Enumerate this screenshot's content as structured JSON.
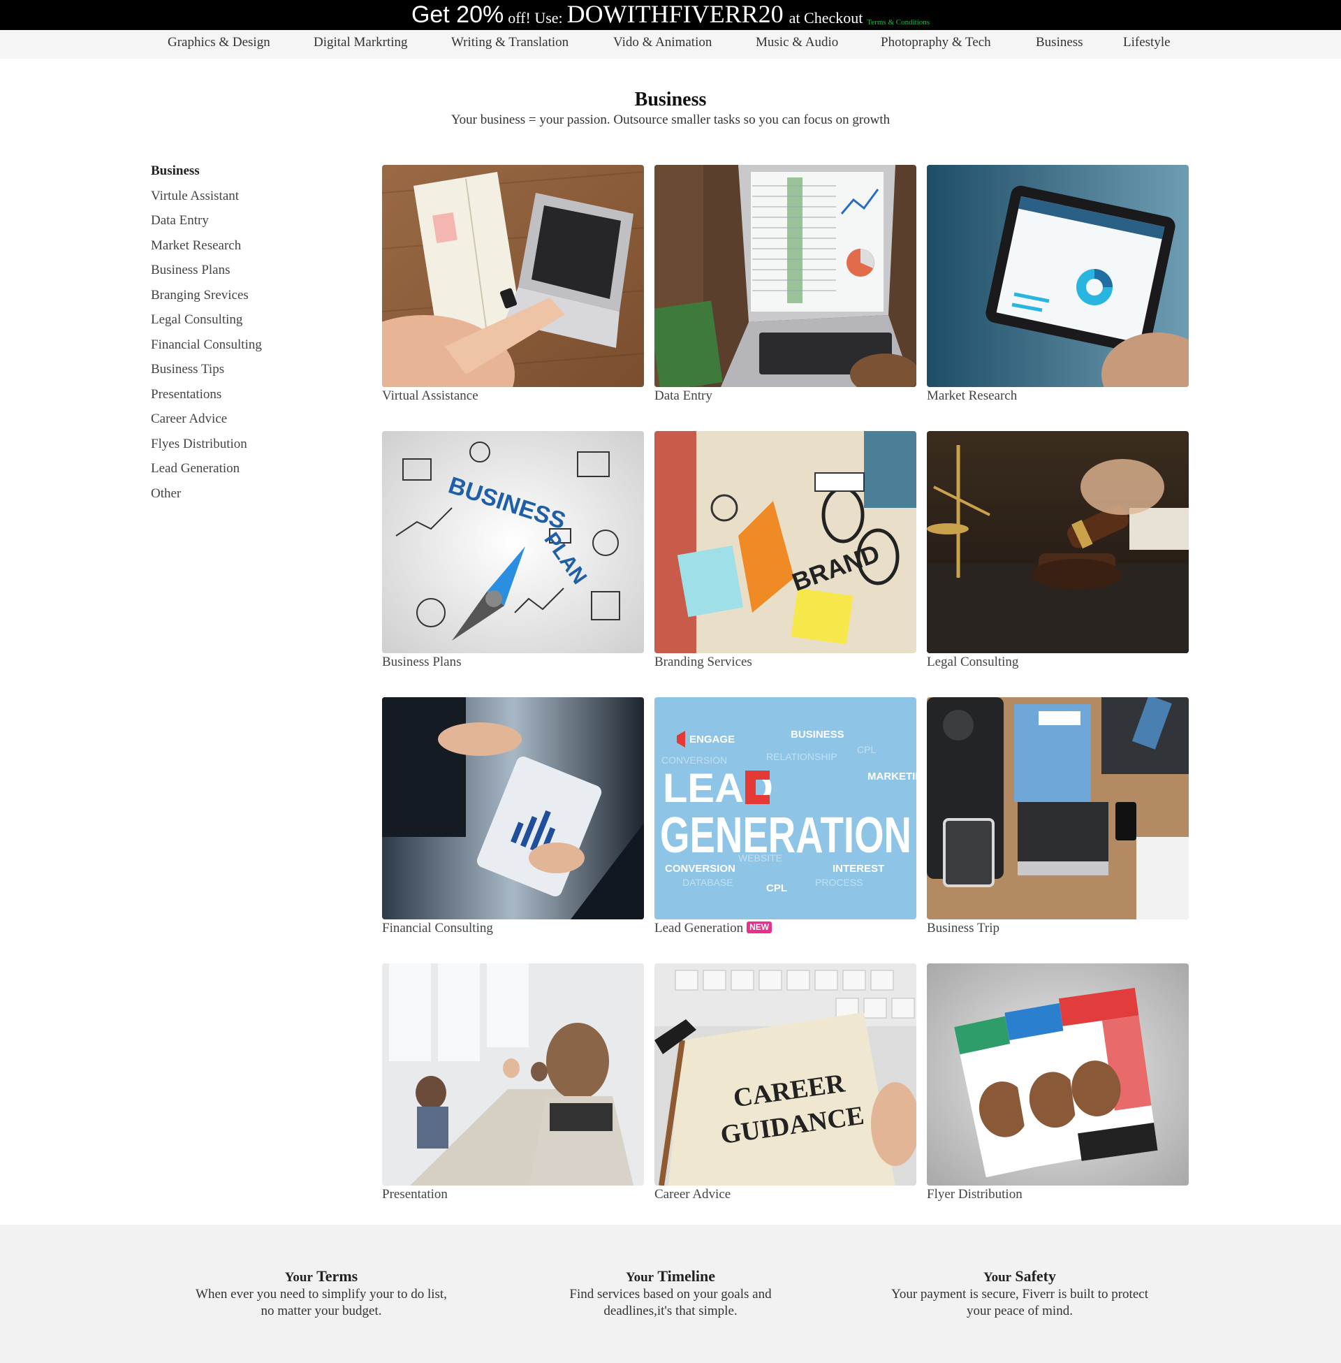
{
  "promo": {
    "get": "Get 20%",
    "off_use": "off! Use:",
    "code": "DOWITHFIVERR20",
    "at_checkout": "at Checkout",
    "terms": "Terms & Conditions"
  },
  "nav": {
    "items": [
      "Graphics & Design",
      "Digital Markrting",
      "Writing & Translation",
      "Vido & Animation",
      "Music & Audio",
      "Photopraphy & Tech",
      "Business",
      "Lifestyle"
    ]
  },
  "header": {
    "title": "Business",
    "subtitle": "Your business = your passion. Outsource smaller tasks so you can focus on growth"
  },
  "sidebar": {
    "heading": "Business",
    "items": [
      "Virtule Assistant",
      "Data Entry",
      "Market Research",
      "Business Plans",
      "Branging Srevices",
      "Legal Consulting",
      "Financial Consulting",
      "Business Tips",
      "Presentations",
      "Career Advice",
      "Flyes Distribution",
      "Lead Generation",
      "Other"
    ]
  },
  "cards": [
    {
      "label": "Virtual Assistance",
      "image": "laptop-desk-photo"
    },
    {
      "label": "Data Entry",
      "image": "spreadsheet-laptop-photo"
    },
    {
      "label": "Market Research",
      "image": "tablet-dashboard-photo"
    },
    {
      "label": "Business Plans",
      "image": "business-plan-sketch"
    },
    {
      "label": "Branding Services",
      "image": "brand-doodle-photo"
    },
    {
      "label": "Legal Consulting",
      "image": "gavel-scales-photo"
    },
    {
      "label": "Financial Consulting",
      "image": "handshake-tablet-photo"
    },
    {
      "label": "Lead Generation",
      "badge": "NEW",
      "image": "lead-generation-illustration"
    },
    {
      "label": "Business Trip",
      "image": "travel-flatlay-photo"
    },
    {
      "label": "Presentation",
      "image": "meeting-room-photo"
    },
    {
      "label": "Career Advice",
      "image": "career-guidance-notebook-photo"
    },
    {
      "label": "Flyer Distribution",
      "image": "flyer-mockup-photo"
    }
  ],
  "footer": {
    "columns": [
      {
        "title_a": "Your",
        "title_b": "Terms",
        "text_1": "When ever you need to simplify your to do list,",
        "text_2": "no matter your budget."
      },
      {
        "title_a": "Your",
        "title_b": "Timeline",
        "text_1": "Find services based on your goals and",
        "text_2": "deadlines,it's that simple."
      },
      {
        "title_a": "Your",
        "title_b": "Safety",
        "text_1": "Your payment is secure, Fiverr is built to protect",
        "text_2": "your peace of mind."
      }
    ]
  },
  "colors": {
    "promo_bg": "#000000",
    "terms_link": "#1db954",
    "badge": "#e8308c",
    "nav_bg": "#f5f5f5",
    "footer_bg": "#f2f2f2"
  }
}
